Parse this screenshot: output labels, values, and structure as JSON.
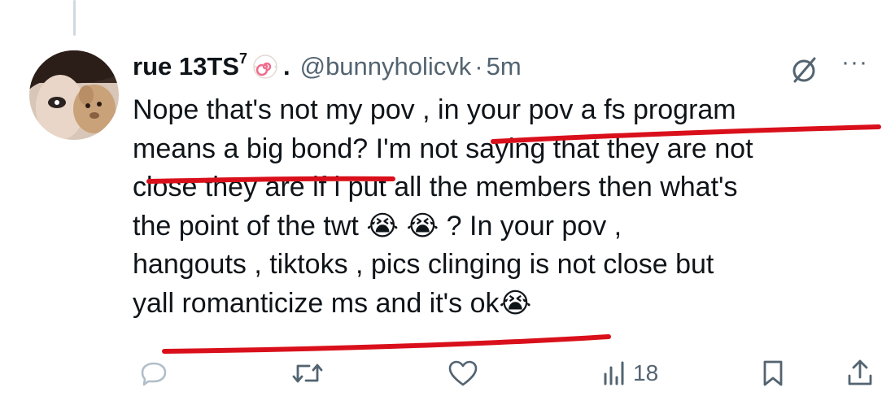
{
  "tweet": {
    "display_name": "rue 13TS",
    "name_superscript": "7",
    "name_suffix": ".",
    "handle": "@bunnyholicvk",
    "separator": "·",
    "time": "5m",
    "text": "Nope that's not my pov , in your pov a fs program\nmeans a big bond? I'm not saying that they are not\nclose they are if i put all the members then what's\nthe point of the twt 😭 😭 ? In your pov ,\nhangouts , tiktoks , pics clinging is not close but\nyall romanticize ms and it's ok😭",
    "more_glyph": "···"
  },
  "annotations": {
    "underline_color": "#d9101b"
  },
  "actions": {
    "views_count": "18"
  },
  "icons": {
    "badge": "fishcake-emoji-icon",
    "grok": "grok-icon",
    "reply": "reply-icon",
    "retweet": "retweet-icon",
    "like": "heart-icon",
    "views": "views-icon",
    "bookmark": "bookmark-icon",
    "share": "share-icon"
  },
  "colors": {
    "text": "#0f1419",
    "secondary": "#536471",
    "thread_line": "#cfd9de"
  }
}
